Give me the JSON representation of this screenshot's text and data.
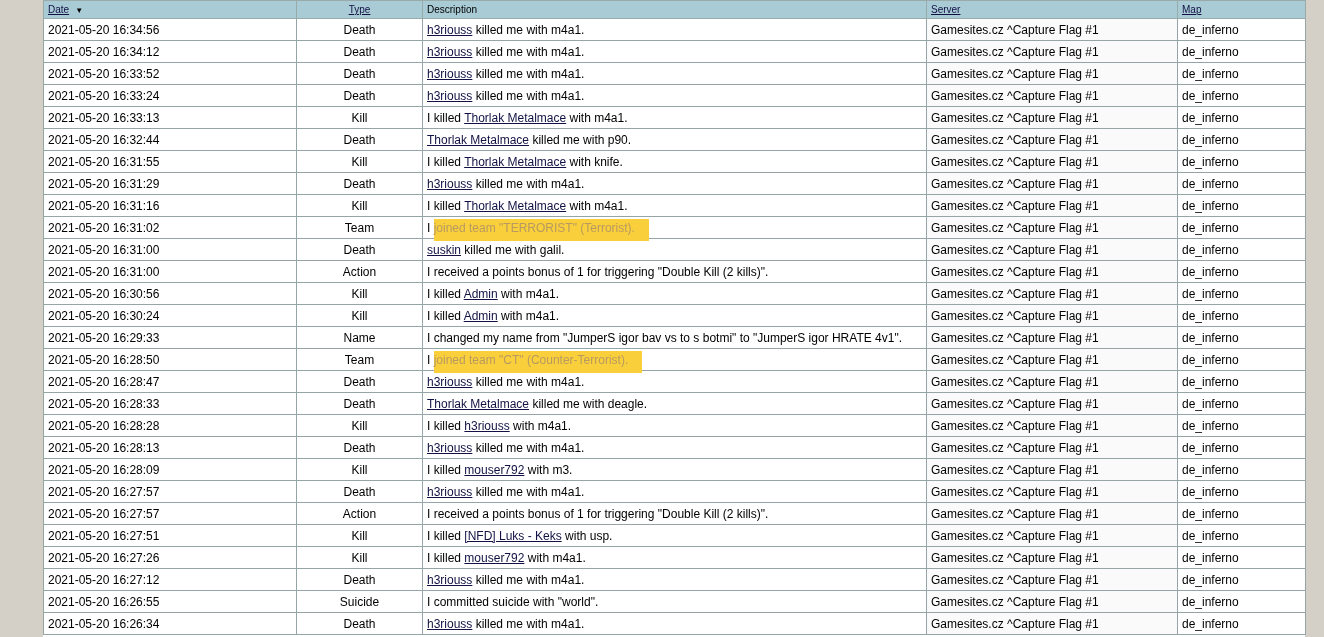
{
  "table": {
    "columns": [
      {
        "label": "Date",
        "sortable": true,
        "sort_arrow": "▼"
      },
      {
        "label": "Type",
        "sortable": true
      },
      {
        "label": "Description",
        "sortable": false
      },
      {
        "label": "Server",
        "sortable": true
      },
      {
        "label": "Map",
        "sortable": true
      }
    ],
    "rows": [
      {
        "date": "2021-05-20 16:34:56",
        "type": "Death",
        "description": [
          {
            "kind": "link",
            "text": "h3riouss"
          },
          {
            "kind": "plain",
            "text": " killed me with m4a1."
          }
        ],
        "server": "Gamesites.cz ^Capture Flag #1",
        "map": "de_inferno"
      },
      {
        "date": "2021-05-20 16:34:12",
        "type": "Death",
        "description": [
          {
            "kind": "link",
            "text": "h3riouss"
          },
          {
            "kind": "plain",
            "text": " killed me with m4a1."
          }
        ],
        "server": "Gamesites.cz ^Capture Flag #1",
        "map": "de_inferno"
      },
      {
        "date": "2021-05-20 16:33:52",
        "type": "Death",
        "description": [
          {
            "kind": "link",
            "text": "h3riouss"
          },
          {
            "kind": "plain",
            "text": " killed me with m4a1."
          }
        ],
        "server": "Gamesites.cz ^Capture Flag #1",
        "map": "de_inferno"
      },
      {
        "date": "2021-05-20 16:33:24",
        "type": "Death",
        "description": [
          {
            "kind": "link",
            "text": "h3riouss"
          },
          {
            "kind": "plain",
            "text": " killed me with m4a1."
          }
        ],
        "server": "Gamesites.cz ^Capture Flag #1",
        "map": "de_inferno"
      },
      {
        "date": "2021-05-20 16:33:13",
        "type": "Kill",
        "description": [
          {
            "kind": "plain",
            "text": "I killed "
          },
          {
            "kind": "link",
            "text": "Thorlak Metalmace"
          },
          {
            "kind": "plain",
            "text": " with m4a1."
          }
        ],
        "server": "Gamesites.cz ^Capture Flag #1",
        "map": "de_inferno"
      },
      {
        "date": "2021-05-20 16:32:44",
        "type": "Death",
        "description": [
          {
            "kind": "link",
            "text": "Thorlak Metalmace"
          },
          {
            "kind": "plain",
            "text": " killed me with p90."
          }
        ],
        "server": "Gamesites.cz ^Capture Flag #1",
        "map": "de_inferno"
      },
      {
        "date": "2021-05-20 16:31:55",
        "type": "Kill",
        "description": [
          {
            "kind": "plain",
            "text": "I killed "
          },
          {
            "kind": "link",
            "text": "Thorlak Metalmace"
          },
          {
            "kind": "plain",
            "text": " with knife."
          }
        ],
        "server": "Gamesites.cz ^Capture Flag #1",
        "map": "de_inferno"
      },
      {
        "date": "2021-05-20 16:31:29",
        "type": "Death",
        "description": [
          {
            "kind": "link",
            "text": "h3riouss"
          },
          {
            "kind": "plain",
            "text": " killed me with m4a1."
          }
        ],
        "server": "Gamesites.cz ^Capture Flag #1",
        "map": "de_inferno"
      },
      {
        "date": "2021-05-20 16:31:16",
        "type": "Kill",
        "description": [
          {
            "kind": "plain",
            "text": "I killed "
          },
          {
            "kind": "link",
            "text": "Thorlak Metalmace"
          },
          {
            "kind": "plain",
            "text": " with m4a1."
          }
        ],
        "server": "Gamesites.cz ^Capture Flag #1",
        "map": "de_inferno"
      },
      {
        "date": "2021-05-20 16:31:02",
        "type": "Team",
        "description": [
          {
            "kind": "plain",
            "text": "I "
          },
          {
            "kind": "highlight",
            "text": "joined team \"TERRORIST\" (Terrorist)."
          }
        ],
        "server": "Gamesites.cz ^Capture Flag #1",
        "map": "de_inferno"
      },
      {
        "date": "2021-05-20 16:31:00",
        "type": "Death",
        "description": [
          {
            "kind": "link",
            "text": "suskin"
          },
          {
            "kind": "plain",
            "text": " killed me with galil."
          }
        ],
        "server": "Gamesites.cz ^Capture Flag #1",
        "map": "de_inferno"
      },
      {
        "date": "2021-05-20 16:31:00",
        "type": "Action",
        "description": [
          {
            "kind": "plain",
            "text": "I received a points bonus of 1 for triggering \"Double Kill (2 kills)\"."
          }
        ],
        "server": "Gamesites.cz ^Capture Flag #1",
        "map": "de_inferno"
      },
      {
        "date": "2021-05-20 16:30:56",
        "type": "Kill",
        "description": [
          {
            "kind": "plain",
            "text": "I killed "
          },
          {
            "kind": "link",
            "text": "Admin"
          },
          {
            "kind": "plain",
            "text": " with m4a1."
          }
        ],
        "server": "Gamesites.cz ^Capture Flag #1",
        "map": "de_inferno"
      },
      {
        "date": "2021-05-20 16:30:24",
        "type": "Kill",
        "description": [
          {
            "kind": "plain",
            "text": "I killed "
          },
          {
            "kind": "link",
            "text": "Admin"
          },
          {
            "kind": "plain",
            "text": " with m4a1."
          }
        ],
        "server": "Gamesites.cz ^Capture Flag #1",
        "map": "de_inferno"
      },
      {
        "date": "2021-05-20 16:29:33",
        "type": "Name",
        "description": [
          {
            "kind": "plain",
            "text": "I changed my name from \"JumperS igor bav vs to s botmi\" to \"JumperS igor HRATE 4v1\"."
          }
        ],
        "server": "Gamesites.cz ^Capture Flag #1",
        "map": "de_inferno"
      },
      {
        "date": "2021-05-20 16:28:50",
        "type": "Team",
        "description": [
          {
            "kind": "plain",
            "text": "I "
          },
          {
            "kind": "highlight",
            "text": "joined team \"CT\" (Counter-Terrorist)."
          }
        ],
        "server": "Gamesites.cz ^Capture Flag #1",
        "map": "de_inferno"
      },
      {
        "date": "2021-05-20 16:28:47",
        "type": "Death",
        "description": [
          {
            "kind": "link",
            "text": "h3riouss"
          },
          {
            "kind": "plain",
            "text": " killed me with m4a1."
          }
        ],
        "server": "Gamesites.cz ^Capture Flag #1",
        "map": "de_inferno"
      },
      {
        "date": "2021-05-20 16:28:33",
        "type": "Death",
        "description": [
          {
            "kind": "link",
            "text": "Thorlak Metalmace"
          },
          {
            "kind": "plain",
            "text": " killed me with deagle."
          }
        ],
        "server": "Gamesites.cz ^Capture Flag #1",
        "map": "de_inferno"
      },
      {
        "date": "2021-05-20 16:28:28",
        "type": "Kill",
        "description": [
          {
            "kind": "plain",
            "text": "I killed "
          },
          {
            "kind": "link",
            "text": "h3riouss"
          },
          {
            "kind": "plain",
            "text": " with m4a1."
          }
        ],
        "server": "Gamesites.cz ^Capture Flag #1",
        "map": "de_inferno"
      },
      {
        "date": "2021-05-20 16:28:13",
        "type": "Death",
        "description": [
          {
            "kind": "link",
            "text": "h3riouss"
          },
          {
            "kind": "plain",
            "text": " killed me with m4a1."
          }
        ],
        "server": "Gamesites.cz ^Capture Flag #1",
        "map": "de_inferno"
      },
      {
        "date": "2021-05-20 16:28:09",
        "type": "Kill",
        "description": [
          {
            "kind": "plain",
            "text": "I killed "
          },
          {
            "kind": "link",
            "text": "mouser792"
          },
          {
            "kind": "plain",
            "text": " with m3."
          }
        ],
        "server": "Gamesites.cz ^Capture Flag #1",
        "map": "de_inferno"
      },
      {
        "date": "2021-05-20 16:27:57",
        "type": "Death",
        "description": [
          {
            "kind": "link",
            "text": "h3riouss"
          },
          {
            "kind": "plain",
            "text": " killed me with m4a1."
          }
        ],
        "server": "Gamesites.cz ^Capture Flag #1",
        "map": "de_inferno"
      },
      {
        "date": "2021-05-20 16:27:57",
        "type": "Action",
        "description": [
          {
            "kind": "plain",
            "text": "I received a points bonus of 1 for triggering \"Double Kill (2 kills)\"."
          }
        ],
        "server": "Gamesites.cz ^Capture Flag #1",
        "map": "de_inferno"
      },
      {
        "date": "2021-05-20 16:27:51",
        "type": "Kill",
        "description": [
          {
            "kind": "plain",
            "text": "I killed "
          },
          {
            "kind": "link",
            "text": "[NFD] Luks - Keks"
          },
          {
            "kind": "plain",
            "text": " with usp."
          }
        ],
        "server": "Gamesites.cz ^Capture Flag #1",
        "map": "de_inferno"
      },
      {
        "date": "2021-05-20 16:27:26",
        "type": "Kill",
        "description": [
          {
            "kind": "plain",
            "text": "I killed "
          },
          {
            "kind": "link",
            "text": "mouser792"
          },
          {
            "kind": "plain",
            "text": " with m4a1."
          }
        ],
        "server": "Gamesites.cz ^Capture Flag #1",
        "map": "de_inferno"
      },
      {
        "date": "2021-05-20 16:27:12",
        "type": "Death",
        "description": [
          {
            "kind": "link",
            "text": "h3riouss"
          },
          {
            "kind": "plain",
            "text": " killed me with m4a1."
          }
        ],
        "server": "Gamesites.cz ^Capture Flag #1",
        "map": "de_inferno"
      },
      {
        "date": "2021-05-20 16:26:55",
        "type": "Suicide",
        "description": [
          {
            "kind": "plain",
            "text": "I committed suicide with \"world\"."
          }
        ],
        "server": "Gamesites.cz ^Capture Flag #1",
        "map": "de_inferno"
      },
      {
        "date": "2021-05-20 16:26:34",
        "type": "Death",
        "description": [
          {
            "kind": "link",
            "text": "h3riouss"
          },
          {
            "kind": "plain",
            "text": " killed me with m4a1."
          }
        ],
        "server": "Gamesites.cz ^Capture Flag #1",
        "map": "de_inferno"
      }
    ]
  }
}
